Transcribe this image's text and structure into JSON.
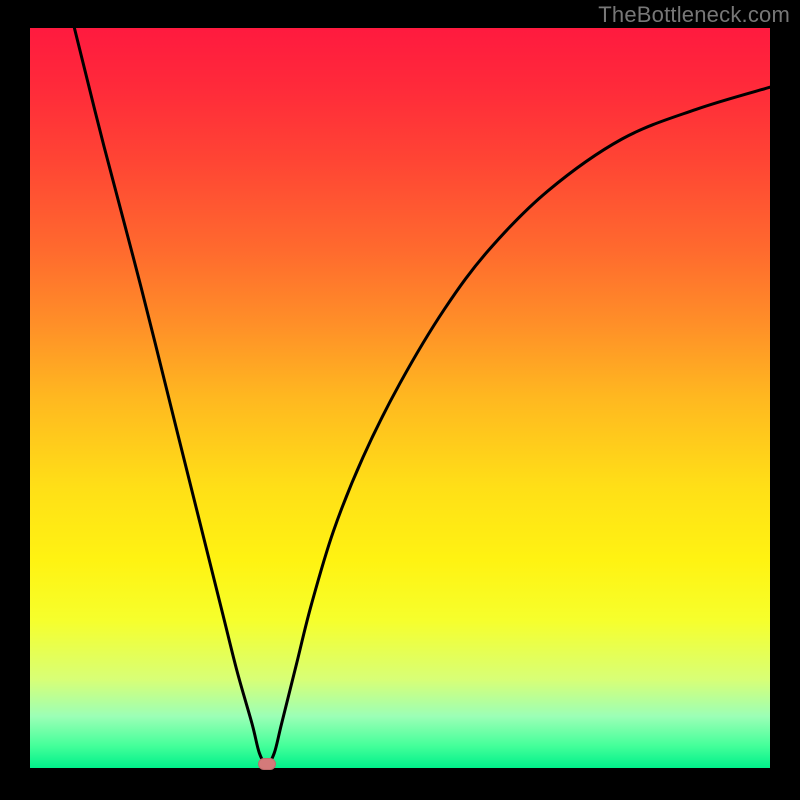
{
  "watermark": "TheBottleneck.com",
  "chart_data": {
    "type": "line",
    "title": "",
    "xlabel": "",
    "ylabel": "",
    "xlim": [
      0,
      100
    ],
    "ylim": [
      0,
      100
    ],
    "series": [
      {
        "name": "curve",
        "x": [
          6,
          10,
          15,
          20,
          23,
          26,
          28,
          30,
          31,
          32,
          33,
          34,
          36,
          38,
          41,
          45,
          50,
          56,
          62,
          70,
          80,
          90,
          100
        ],
        "y": [
          100,
          84,
          65,
          45,
          33,
          21,
          13,
          6,
          2,
          0.5,
          2,
          6,
          14,
          22,
          32,
          42,
          52,
          62,
          70,
          78,
          85,
          89,
          92
        ]
      }
    ],
    "marker": {
      "x": 32,
      "y": 0.5,
      "color": "#d47a7a"
    },
    "gradient_colors": {
      "top": "#ff1a3f",
      "mid_upper": "#ff8f28",
      "mid": "#ffdf17",
      "mid_lower": "#f6ff2c",
      "bottom": "#00f08a"
    }
  }
}
